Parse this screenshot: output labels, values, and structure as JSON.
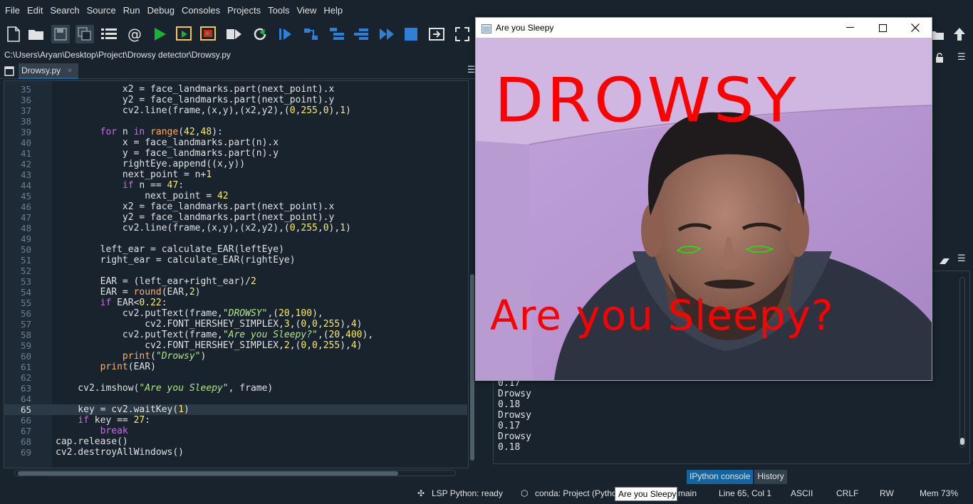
{
  "menu": [
    "File",
    "Edit",
    "Search",
    "Source",
    "Run",
    "Debug",
    "Consoles",
    "Projects",
    "Tools",
    "View",
    "Help"
  ],
  "path": "C:\\Users\\Aryan\\Desktop\\Project\\Drowsy detector\\Drowsy.py",
  "editor_tab": {
    "label": "Drowsy.py",
    "close": "×"
  },
  "code_lines": [
    {
      "n": "35",
      "html": "            x2 = face_landmarks.part(next_point).x"
    },
    {
      "n": "36",
      "html": "            y2 = face_landmarks.part(next_point).y"
    },
    {
      "n": "37",
      "html": "            cv2.line(frame,(x,y),(x2,y2),(<span class=\"num\">0</span>,<span class=\"num\">255</span>,<span class=\"num\">0</span>),<span class=\"num\">1</span>)"
    },
    {
      "n": "38",
      "html": ""
    },
    {
      "n": "39",
      "html": "        <span class=\"kw\">for</span> n <span class=\"kw\">in</span> <span class=\"bi\">range</span>(<span class=\"num\">42</span>,<span class=\"num\">48</span>):"
    },
    {
      "n": "40",
      "html": "            x = face_landmarks.part(n).x"
    },
    {
      "n": "41",
      "html": "            y = face_landmarks.part(n).y"
    },
    {
      "n": "42",
      "html": "            rightEye.append((x,y))"
    },
    {
      "n": "43",
      "html": "            next_point = n+<span class=\"num\">1</span>"
    },
    {
      "n": "44",
      "html": "            <span class=\"kw\">if</span> n == <span class=\"num\">47</span>:"
    },
    {
      "n": "45",
      "html": "                next_point = <span class=\"num\">42</span>"
    },
    {
      "n": "46",
      "html": "            x2 = face_landmarks.part(next_point).x"
    },
    {
      "n": "47",
      "html": "            y2 = face_landmarks.part(next_point).y"
    },
    {
      "n": "48",
      "html": "            cv2.line(frame,(x,y),(x2,y2),(<span class=\"num\">0</span>,<span class=\"num\">255</span>,<span class=\"num\">0</span>),<span class=\"num\">1</span>)"
    },
    {
      "n": "49",
      "html": ""
    },
    {
      "n": "50",
      "html": "        left_ear = calculate_EAR(leftEye)"
    },
    {
      "n": "51",
      "html": "        right_ear = calculate_EAR(rightEye)"
    },
    {
      "n": "52",
      "html": ""
    },
    {
      "n": "53",
      "html": "        EAR = (left_ear+right_ear)/<span class=\"num\">2</span>"
    },
    {
      "n": "54",
      "html": "        EAR = <span class=\"bi\">round</span>(EAR,<span class=\"num\">2</span>)"
    },
    {
      "n": "55",
      "html": "        <span class=\"kw\">if</span> EAR&lt;<span class=\"num\">0.22</span>:"
    },
    {
      "n": "56",
      "html": "            cv2.putText(frame,<span class=\"str\">\"DROWSY\"</span>,(<span class=\"num\">20</span>,<span class=\"num\">100</span>),"
    },
    {
      "n": "57",
      "html": "                cv2.FONT_HERSHEY_SIMPLEX,<span class=\"num\">3</span>,(<span class=\"num\">0</span>,<span class=\"num\">0</span>,<span class=\"num\">255</span>),<span class=\"num\">4</span>)"
    },
    {
      "n": "58",
      "html": "            cv2.putText(frame,<span class=\"str\">\"Are you Sleepy?\"</span>,(<span class=\"num\">20</span>,<span class=\"num\">400</span>),"
    },
    {
      "n": "59",
      "html": "                cv2.FONT_HERSHEY_SIMPLEX,<span class=\"num\">2</span>,(<span class=\"num\">0</span>,<span class=\"num\">0</span>,<span class=\"num\">255</span>),<span class=\"num\">4</span>)"
    },
    {
      "n": "60",
      "html": "            <span class=\"bi\">print</span>(<span class=\"str\">\"Drowsy\"</span>)"
    },
    {
      "n": "61",
      "html": "        <span class=\"bi\">print</span>(EAR)"
    },
    {
      "n": "62",
      "html": ""
    },
    {
      "n": "63",
      "html": "    cv2.imshow(<span class=\"str\">\"Are you Sleepy\"</span>, frame)"
    },
    {
      "n": "64",
      "html": ""
    },
    {
      "n": "65",
      "html": "    key = cv2.waitKey(<span class=\"num\">1</span>)",
      "current": true
    },
    {
      "n": "66",
      "html": "    <span class=\"kw\">if</span> key == <span class=\"num\">27</span>:"
    },
    {
      "n": "67",
      "html": "        <span class=\"kw\">break</span>"
    },
    {
      "n": "68",
      "html": "cap.release()"
    },
    {
      "n": "69",
      "html": "cv2.destroyAllWindows()"
    }
  ],
  "console": {
    "lines": [
      "0.17",
      "Drowsy",
      "0.18",
      "Drowsy",
      "0.17",
      "Drowsy",
      "0.18"
    ],
    "tabs": [
      "IPython console",
      "History"
    ]
  },
  "popup": {
    "title": "Are you Sleepy",
    "overlay_top": "DROWSY",
    "overlay_bottom": "Are you Sleepy?"
  },
  "status": {
    "lsp": "LSP Python: ready",
    "conda": "conda: Project (Python",
    "branch": "main",
    "position": "Line 65, Col 1",
    "encoding": "ASCII",
    "eol": "CRLF",
    "perm": "RW",
    "mem": "Mem 73%"
  },
  "tooltip": "Are you Sleepy",
  "colors": {
    "bg": "#19232d",
    "accent": "#1464a0",
    "overlay_red": "#ff0000",
    "eye_green": "#00ff00",
    "wall_purple": "#b99ad2"
  }
}
